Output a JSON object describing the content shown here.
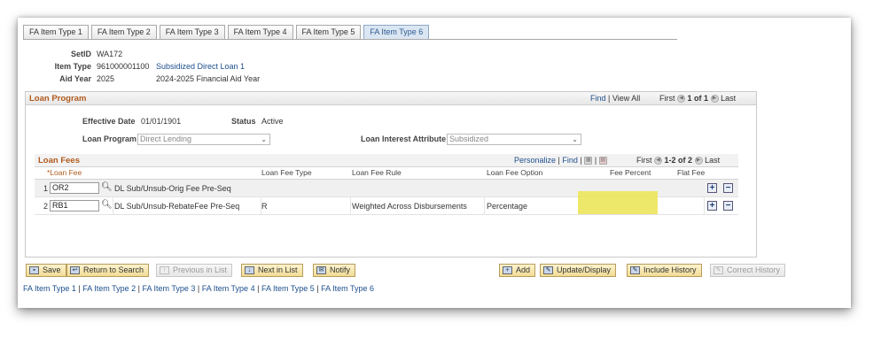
{
  "tabs": [
    "FA Item Type 1",
    "FA Item Type 2",
    "FA Item Type 3",
    "FA Item Type 4",
    "FA Item Type 5",
    "FA Item Type 6"
  ],
  "active_tab": 5,
  "header": {
    "setid_label": "SetID",
    "setid_value": "WA172",
    "itemtype_label": "Item Type",
    "itemtype_value": "961000001100",
    "itemtype_desc": "Subsidized Direct Loan 1",
    "aidyear_label": "Aid Year",
    "aidyear_value": "2025",
    "aidyear_desc": "2024-2025 Financial Aid Year"
  },
  "loan_program": {
    "title": "Loan Program",
    "nav": {
      "find": "Find",
      "sep": "|",
      "view_all": "View All",
      "first": "First",
      "count": "1 of 1",
      "last": "Last"
    },
    "effective_date_label": "Effective Date",
    "effective_date_value": "01/01/1901",
    "status_label": "Status",
    "status_value": "Active",
    "loan_program_label": "Loan Program",
    "loan_program_value": "Direct Lending",
    "interest_label": "Loan Interest Attribute",
    "interest_value": "Subsidized"
  },
  "loan_fees": {
    "title": "Loan Fees",
    "nav": {
      "personalize": "Personalize",
      "sep": "|",
      "find": "Find",
      "sep2": "|",
      "first": "First",
      "count": "1-2 of 2",
      "last": "Last"
    },
    "columns": {
      "loan_fee": "*Loan Fee",
      "fee_type": "Loan Fee Type",
      "fee_rule": "Loan Fee Rule",
      "fee_option": "Loan Fee Option",
      "fee_percent": "Fee Percent",
      "flat_fee": "Flat Fee"
    },
    "rows": [
      {
        "num": "1",
        "code": "OR2",
        "desc": "DL Sub/Unsub-Orig Fee Pre-Seq",
        "type": "",
        "rule": "",
        "option": ""
      },
      {
        "num": "2",
        "code": "RB1",
        "desc": "DL Sub/Unsub-RebateFee Pre-Seq",
        "type": "R",
        "rule": "Weighted Across Disbursements",
        "option": "Percentage"
      }
    ]
  },
  "buttons": {
    "save": "Save",
    "return": "Return to Search",
    "prev": "Previous in List",
    "next": "Next in List",
    "notify": "Notify",
    "add": "Add",
    "update": "Update/Display",
    "history": "Include History",
    "correct": "Correct History"
  },
  "footer_links": [
    "FA Item Type 1",
    "FA Item Type 2",
    "FA Item Type 3",
    "FA Item Type 4",
    "FA Item Type 5",
    "FA Item Type 6"
  ],
  "colors": {
    "section_title": "#b05a1e",
    "link": "#1d4f8c",
    "highlight": "#ece55a"
  }
}
